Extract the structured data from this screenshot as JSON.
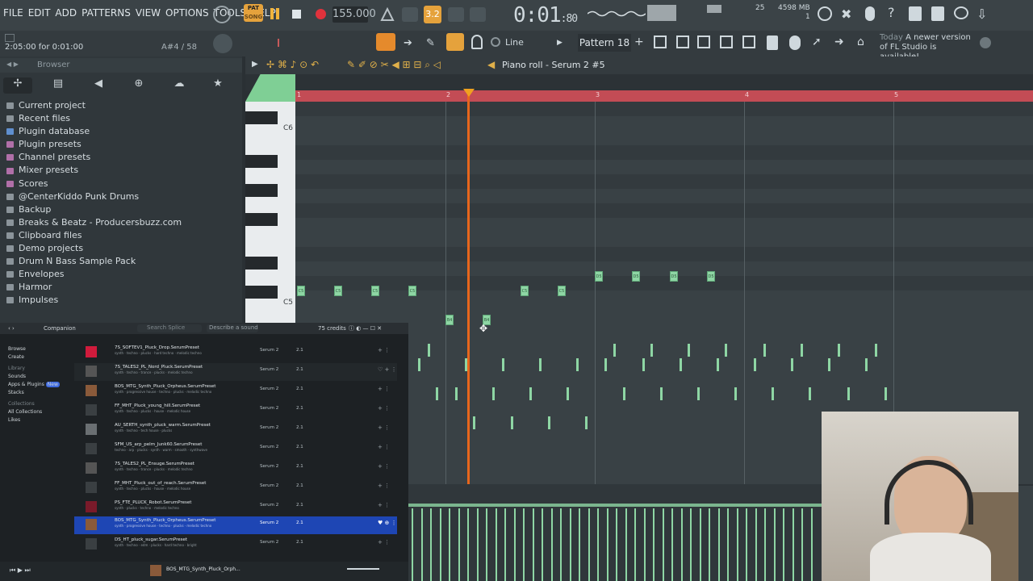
{
  "menu": [
    "FILE",
    "EDIT",
    "ADD",
    "PATTERNS",
    "VIEW",
    "OPTIONS",
    "TOOLS",
    "HELP"
  ],
  "transport": {
    "pat_label": "PAT",
    "song_label": "SONG",
    "tempo": "155.000",
    "time": "0:01",
    "time_frac": "80",
    "cpu": "25",
    "memory": "4598 MB",
    "mem_sub": "1",
    "step_label": "3.2"
  },
  "hint": "2:05:00 for 0:01:00",
  "note_readout": "A#4 / 58",
  "pattern": "Pattern 18",
  "snap_mode": "Line",
  "news": {
    "when": "Today",
    "text": "A newer version of FL Studio is available!"
  },
  "browser": {
    "title": "Browser",
    "items": [
      "Current project",
      "Recent files",
      "Plugin database",
      "Plugin presets",
      "Channel presets",
      "Mixer presets",
      "Scores",
      "@CenterKiddo Punk Drums",
      "Backup",
      "Breaks & Beatz - Producersbuzz.com",
      "Clipboard files",
      "Demo projects",
      "Drum N Bass Sample Pack",
      "Envelopes",
      "Harmor",
      "Impulses"
    ]
  },
  "piano_roll": {
    "title": "Piano roll - Serum 2 #5",
    "bars": [
      "1",
      "2",
      "3",
      "4",
      "5"
    ],
    "key_labels": [
      "C6",
      "C5"
    ]
  },
  "companion": {
    "title": "Companion",
    "search_placeholder": "Search Splice",
    "describe": "Describe a sound",
    "credits": "75 credits",
    "side": [
      "Browse",
      "Create",
      "Library",
      "Sounds",
      "Apps & Plugins",
      "Stacks",
      "Collections",
      "All Collections",
      "Likes"
    ],
    "new_badge": "New",
    "rows": [
      {
        "name": "7S_SOFTEV1_Pluck_Drop.SerumPreset",
        "tags": "synth · techno · plucks · hard techno · melodic techno",
        "plugin": "Serum 2",
        "ver": "2.1"
      },
      {
        "name": "7S_TALES2_PL_Nord_Pluck.SerumPreset",
        "tags": "synth · techno · trance · plucks · melodic techno",
        "plugin": "Serum 2",
        "ver": "2.1"
      },
      {
        "name": "BOS_MTG_Synth_Pluck_Orpheus.SerumPreset",
        "tags": "synth · progressive house · techno · plucks · melodic techno",
        "plugin": "Serum 2",
        "ver": "2.1"
      },
      {
        "name": "FF_MHT_Pluck_young_hill.SerumPreset",
        "tags": "synth · techno · plucks · house · melodic house",
        "plugin": "Serum 2",
        "ver": "2.1"
      },
      {
        "name": "AU_SERTH_synth_pluck_warm.SerumPreset",
        "tags": "synth · techno · tech house · plucks",
        "plugin": "Serum 2",
        "ver": "2.1"
      },
      {
        "name": "SFM_US_arp_pelm_Junk60.SerumPreset",
        "tags": "techno · arp · plucks · synth · warm · smooth · synthwave",
        "plugin": "Serum 2",
        "ver": "2.1"
      },
      {
        "name": "7S_TALES2_PL_Ensuge.SerumPreset",
        "tags": "synth · techno · trance · plucks · melodic techno",
        "plugin": "Serum 2",
        "ver": "2.1"
      },
      {
        "name": "FF_MHT_Pluck_out_of_reach.SerumPreset",
        "tags": "synth · techno · plucks · house · melodic house",
        "plugin": "Serum 2",
        "ver": "2.1"
      },
      {
        "name": "PS_FTE_PLUCK_Robot.SerumPreset",
        "tags": "synth · plucks · techno · melodic techno",
        "plugin": "Serum 2",
        "ver": "2.1"
      },
      {
        "name": "BOS_MTG_Synth_Pluck_Orpheus.SerumPreset",
        "tags": "synth · progressive house · techno · plucks · melodic techno",
        "plugin": "Serum 2",
        "ver": "2.1"
      },
      {
        "name": "DS_HT_pluck_sugar.SerumPreset",
        "tags": "synth · techno · edm · plucks · hard techno · bright",
        "plugin": "Serum 2",
        "ver": "2.1"
      }
    ],
    "footer_name": "BOS_MTG_Synth_Pluck_Orph..."
  },
  "colors": {
    "ruler": "#c34c55",
    "playhead": "#e8661c",
    "note": "#8ed6a4",
    "selected_row": "#1e46b4"
  }
}
